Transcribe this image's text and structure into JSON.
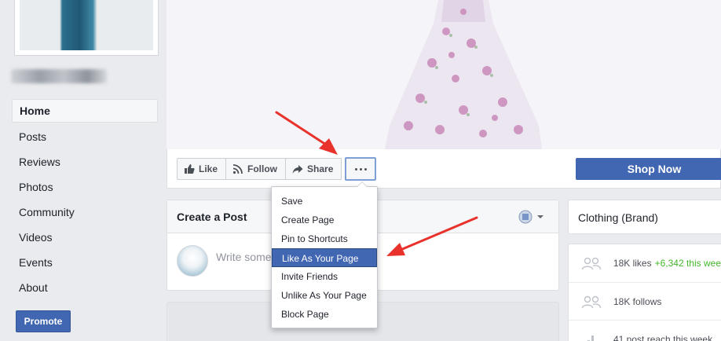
{
  "nav": {
    "items": [
      {
        "label": "Home",
        "active": true
      },
      {
        "label": "Posts"
      },
      {
        "label": "Reviews"
      },
      {
        "label": "Photos"
      },
      {
        "label": "Community"
      },
      {
        "label": "Videos"
      },
      {
        "label": "Events"
      },
      {
        "label": "About"
      }
    ],
    "promote_label": "Promote"
  },
  "actions": {
    "like_label": "Like",
    "follow_label": "Follow",
    "share_label": "Share",
    "shop_now_label": "Shop Now"
  },
  "more_menu": {
    "items": [
      "Save",
      "Create Page",
      "Pin to Shortcuts",
      "Like As Your Page",
      "Invite Friends",
      "Unlike As Your Page",
      "Block Page"
    ],
    "highlighted_index": 3
  },
  "create_post": {
    "title": "Create a Post",
    "input_placeholder": "Write some"
  },
  "about_card": {
    "category": "Clothing (Brand)"
  },
  "stats": {
    "likes": "18K likes",
    "likes_growth": "+6,342 this week",
    "follows": "18K follows",
    "reach": "41 post reach this week"
  },
  "colors": {
    "brand_blue": "#4267b2",
    "growth_green": "#42b72a",
    "annotation_red": "#e8322b"
  }
}
